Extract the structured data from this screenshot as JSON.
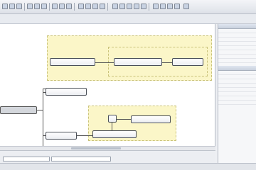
{
  "diagram": {
    "root_label": "",
    "group_top_label": "",
    "group_inner_label": "",
    "group_bottom_label": "",
    "nodes": {
      "n1": "",
      "n2": "",
      "n3": "",
      "n4": "",
      "n5": "",
      "n6": "",
      "n7": ""
    }
  },
  "tabs": [
    "",
    ""
  ],
  "status": {
    "text": ""
  },
  "panel": {
    "title": ""
  }
}
